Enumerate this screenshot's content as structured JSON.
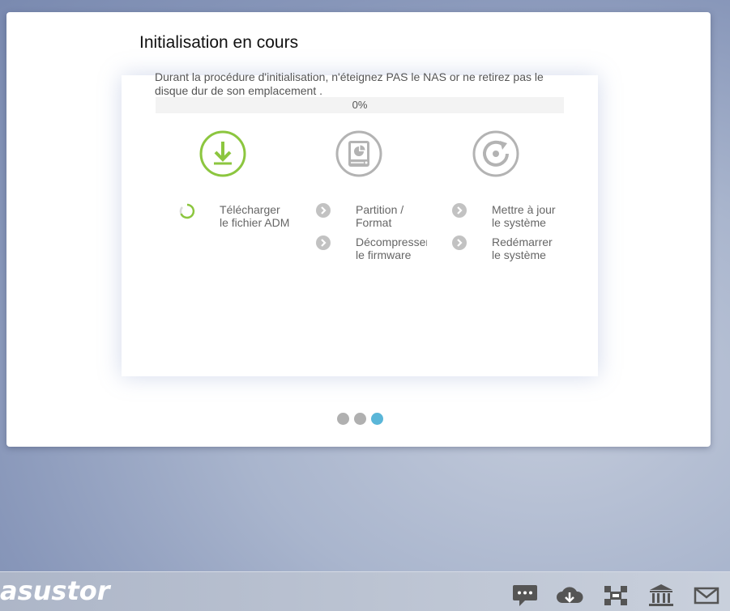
{
  "dialog": {
    "title": "Initialisation en cours",
    "description": "Durant la procédure d'initialisation, n'éteignez PAS le NAS or ne retirez pas le disque dur de son emplacement .",
    "progress": {
      "value": 0,
      "label": "0%"
    },
    "steps": [
      {
        "icon": "download-icon",
        "lines": [
          "Télécharger",
          "le fichier ADM"
        ],
        "status": "in-progress"
      },
      {
        "icon": "disk-partition-icon",
        "lines": [
          "Partition /",
          "Format"
        ],
        "status": "pending"
      },
      {
        "icon": "disk-partition-icon",
        "lines": [
          "Décompresser",
          "le firmware"
        ],
        "status": "pending"
      },
      {
        "icon": "refresh-icon",
        "lines": [
          "Mettre à jour",
          "le système"
        ],
        "status": "pending"
      },
      {
        "icon": "refresh-icon",
        "lines": [
          "Redémarrer",
          "le système"
        ],
        "status": "pending"
      }
    ],
    "pager": {
      "total": 3,
      "active": 3
    },
    "colors": {
      "accent_green": "#8cc63f",
      "pending_gray": "#b3b3b3",
      "active_dot": "#5ab6d8"
    }
  },
  "taskbar": {
    "logo": "asustor",
    "icons": [
      "chat-icon",
      "cloud-download-icon",
      "network-icon",
      "bank-icon",
      "mail-icon"
    ]
  }
}
